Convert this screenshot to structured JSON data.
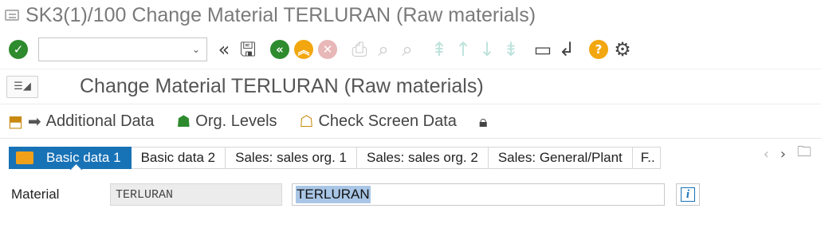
{
  "window": {
    "title": "SK3(1)/100 Change Material TERLURAN (Raw materials)"
  },
  "toolbar": {
    "command_field_value": "",
    "icons": [
      "enter-icon",
      "double-left-arrow-icon",
      "save-icon",
      "back-icon",
      "exit-icon",
      "cancel-icon",
      "print-icon",
      "find-icon",
      "find-next-icon",
      "first-page-icon",
      "previous-page-icon",
      "next-page-icon",
      "last-page-icon",
      "new-session-icon",
      "shortcut-icon",
      "help-icon",
      "settings-icon"
    ]
  },
  "header": {
    "title": "Change Material TERLURAN (Raw materials)"
  },
  "app_toolbar": {
    "additional_data": "Additional Data",
    "org_levels": "Org. Levels",
    "check_screen_data": "Check Screen Data"
  },
  "tabs": [
    {
      "label": "Basic data 1",
      "active": true
    },
    {
      "label": "Basic data 2",
      "active": false
    },
    {
      "label": "Sales: sales org. 1",
      "active": false
    },
    {
      "label": "Sales: sales org. 2",
      "active": false
    },
    {
      "label": "Sales: General/Plant",
      "active": false
    },
    {
      "label": "F..",
      "active": false
    }
  ],
  "material": {
    "label": "Material",
    "number": "TERLURAN",
    "description": "TERLURAN"
  },
  "colors": {
    "active_tab": "#1872b6",
    "enter_green": "#2e8b2e",
    "accent_orange": "#f2a60f"
  }
}
